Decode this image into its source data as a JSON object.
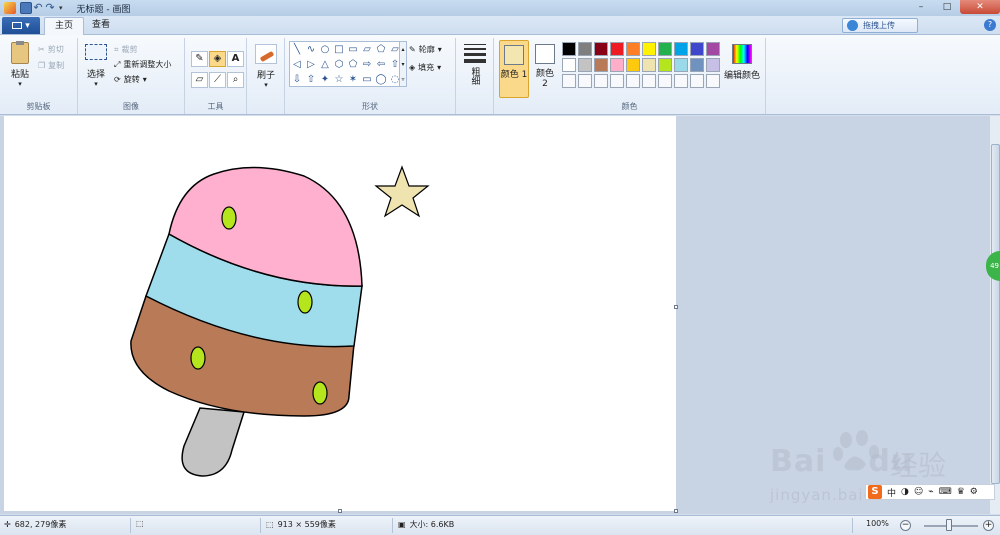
{
  "window": {
    "title": "无标题 - 画图",
    "minimize": "–",
    "maximize": "□",
    "close": "✕"
  },
  "tabs": {
    "file_menu": "▾",
    "home": "主页",
    "view": "查看"
  },
  "upload_button": "拖拽上传",
  "help": "?",
  "ribbon": {
    "clipboard": {
      "label": "剪贴板",
      "paste": "粘贴",
      "cut": "剪切",
      "copy": "复制"
    },
    "image": {
      "label": "图像",
      "select": "选择",
      "crop": "裁剪",
      "resize": "重新调整大小",
      "rotate": "旋转"
    },
    "tools": {
      "label": "工具"
    },
    "brushes": {
      "label": "刷子"
    },
    "shapes": {
      "label": "形状",
      "outline": "轮廓",
      "fill": "填充",
      "glyphs": [
        "╲",
        "∿",
        "○",
        "□",
        "▭",
        "▱",
        "⬠",
        "▱",
        "◁",
        "▷",
        "△",
        "⬡",
        "⬠",
        "⇨",
        "⇦",
        "⇧",
        "⇩",
        "⇧",
        "✦",
        "☆",
        "✶",
        "▭",
        "◯",
        "◌"
      ]
    },
    "size": {
      "label": "粗细"
    },
    "colors": {
      "label": "颜色",
      "color1": "颜色 1",
      "color2": "颜色 2",
      "edit": "编辑颜色",
      "color1_value": "#f4e6b0",
      "color2_value": "#ffffff",
      "palette_row1": [
        "#000000",
        "#7f7f7f",
        "#880015",
        "#ed1c24",
        "#ff7f27",
        "#fff200",
        "#22b14c",
        "#00a2e8",
        "#3f48cc",
        "#a349a4"
      ],
      "palette_row2": [
        "#ffffff",
        "#c3c3c3",
        "#b97a57",
        "#ffaec9",
        "#ffc90e",
        "#efe4b0",
        "#b5e61d",
        "#99d9ea",
        "#7092be",
        "#c8bfe7"
      ]
    }
  },
  "drawing": {
    "top_color": "#ffb0cf",
    "mid_color": "#9fdcec",
    "bottom_color": "#b87a57",
    "stick_color": "#c3c3c3",
    "dots_color": "#b5e61d",
    "star_color": "#efe4b0"
  },
  "status": {
    "cursor": "682, 279像素",
    "canvas_size": "913 × 559像素",
    "file_size": "大小: 6.6KB",
    "zoom": "100%"
  },
  "watermark": {
    "brand": "Bai",
    "brand2": "du",
    "cn": "经验",
    "url": "jingyan.baidu.com"
  },
  "ime": {
    "logo": "S",
    "mode": "中"
  }
}
